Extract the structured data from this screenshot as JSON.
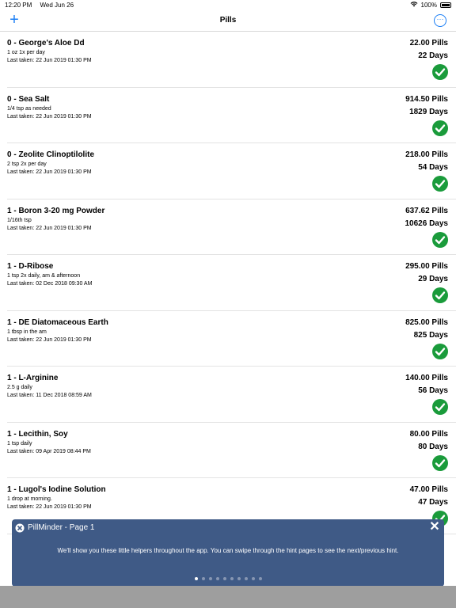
{
  "status_bar": {
    "time": "12:20 PM",
    "date": "Wed Jun 26",
    "battery": "100%"
  },
  "nav": {
    "title": "Pills",
    "add_icon": "plus-icon",
    "more_icon": "more-icon"
  },
  "pills": [
    {
      "name": "0 - George's Aloe Dd",
      "dose": "1 oz 1x per day",
      "last_taken": "Last taken: 22 Jun 2019 01:30 PM",
      "count": "22.00 Pills",
      "days": "22 Days"
    },
    {
      "name": "0 - Sea Salt",
      "dose": "1/4 tsp as needed",
      "last_taken": "Last taken: 22 Jun 2019 01:30 PM",
      "count": "914.50 Pills",
      "days": "1829 Days"
    },
    {
      "name": "0 - Zeolite Clinoptilolite",
      "dose": "2 tsp 2x per day",
      "last_taken": "Last taken: 22 Jun 2019 01:30 PM",
      "count": "218.00 Pills",
      "days": "54 Days"
    },
    {
      "name": "1 - Boron 3-20 mg Powder",
      "dose": "1/16th tsp",
      "last_taken": "Last taken: 22 Jun 2019 01:30 PM",
      "count": "637.62 Pills",
      "days": "10626 Days"
    },
    {
      "name": "1 - D-Ribose",
      "dose": "1 tsp 2x daily, am & afternoon",
      "last_taken": "Last taken: 02 Dec 2018 09:30 AM",
      "count": "295.00 Pills",
      "days": "29 Days"
    },
    {
      "name": "1 - DE Diatomaceous Earth",
      "dose": "1 tbsp in the am",
      "last_taken": "Last taken: 22 Jun 2019 01:30 PM",
      "count": "825.00 Pills",
      "days": "825 Days"
    },
    {
      "name": "1 - L-Arginine",
      "dose": "2.5 g daily",
      "last_taken": "Last taken: 11 Dec 2018 08:59 AM",
      "count": "140.00 Pills",
      "days": "56 Days"
    },
    {
      "name": "1 - Lecithin, Soy",
      "dose": "1 tsp daily",
      "last_taken": "Last taken: 09 Apr 2019 08:44 PM",
      "count": "80.00 Pills",
      "days": "80 Days"
    },
    {
      "name": "1 - Lugol's Iodine Solution",
      "dose": "1 drop at morning.",
      "last_taken": "Last taken: 22 Jun 2019 01:30 PM",
      "count": "47.00 Pills",
      "days": "47 Days"
    }
  ],
  "hint": {
    "title": "PillMinder - Page 1",
    "text": "We'll show you these little helpers throughout the app. You can swipe through the hint pages to see the next/previous hint.",
    "close_icon": "close-icon",
    "page_count": 10,
    "active_page": 0
  }
}
